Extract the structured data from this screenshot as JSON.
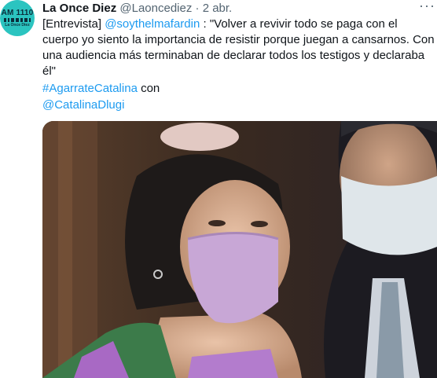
{
  "tweet": {
    "author_name": "La Once Diez",
    "author_handle": "@Laoncediez",
    "separator": "·",
    "date": "2 abr.",
    "more": "···",
    "avatar": {
      "line1": "AM 1110",
      "line2": "La Once Diez"
    },
    "text": {
      "prefix": "[Entrevista] ",
      "mention": "@soythelmafardin",
      "body": " : \"Volver a revivir todo se paga con el cuerpo yo siento la importancia de resistir porque juegan a cansarnos. Con una audiencia más terminaban de declarar todos los testigos y declaraba él\""
    },
    "hashtag": "#AgarrateCatalina",
    "con": " con",
    "mention2": "@CatalinaDlugi"
  },
  "colors": {
    "link": "#1d9bf0",
    "secondary_text": "#536471",
    "avatar_bg": "#2bc4c0"
  }
}
